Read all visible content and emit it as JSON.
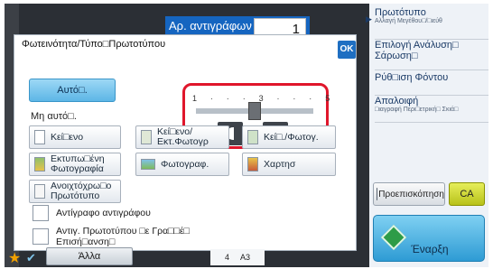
{
  "copies": {
    "label": "Αρ. αντιγράφων",
    "value": "1"
  },
  "dialog": {
    "title": "Φωτεινότητα/Τύπο□Πρωτοτύπου",
    "ok_label": "OK",
    "auto_label": "Αυτό□.",
    "manual_label": "Μη αυτό□.",
    "scale_text": "1 · · · 3 · · · 5",
    "slider_value": 3,
    "slider_min": 1,
    "slider_max": 5,
    "types": [
      {
        "label": "Κεί□ενο",
        "icon": "text-doc-icon"
      },
      {
        "label": "Κεί□ενο/ Εκτ.Φωτογρ",
        "icon": "text-printed-photo-icon"
      },
      {
        "label": "Κεί□./Φωτογ.",
        "icon": "text-photo-icon"
      },
      {
        "label": "Εκτυπω□ένη Φωτογραφία",
        "icon": "printed-photo-icon"
      },
      {
        "label": "Φωτογραφ.",
        "icon": "photo-icon"
      },
      {
        "label": "Χαρτησ",
        "icon": "map-icon"
      },
      {
        "label": "Ανοιχτόχρω□ο Πρωτότυπο",
        "icon": "light-original-icon"
      }
    ],
    "copy_of_copy_label": "Αντίγραφο αντιγράφου",
    "bleed_label": "Αντιγ. Πρωτοτύπου □ε Γρα□□έ□ Επισή□ανση□"
  },
  "right_panel": {
    "original_title": "Πρωτότυπο",
    "original_sub": "Αλλαγή Μεγέθου□/□ιεύθ",
    "resolution": "Επιλογή Ανάλυση□ Σάρωση□",
    "bg": "Ρύθ□ιση Φόντου",
    "erase_title": "Απαλοιφή",
    "erase_sub": "□ιαγραφή Περι□ετρική□ Σκιά□",
    "preview": "Προεπισκόπηση",
    "ca": "CA",
    "start": "Έναρξη"
  },
  "bottom": {
    "other_label": "Άλλα",
    "paper_count": "4",
    "paper_size": "A3"
  }
}
